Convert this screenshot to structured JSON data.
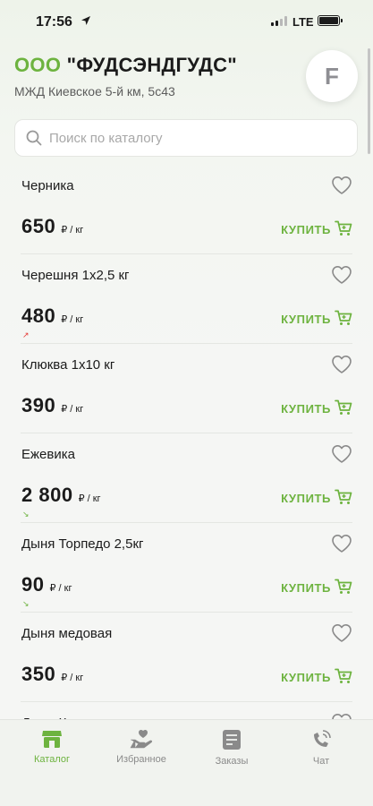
{
  "status_bar": {
    "time": "17:56",
    "network": "LTE"
  },
  "header": {
    "company_prefix": "ООО",
    "company_name": "\"ФУДСЭНДГУДС\"",
    "address": "МЖД Киевское 5-й км, 5с43",
    "avatar_letter": "F"
  },
  "search": {
    "placeholder": "Поиск по каталогу",
    "value": ""
  },
  "colors": {
    "accent": "#6db33f",
    "trend_up": "#e53935"
  },
  "products": [
    {
      "name": "Черника",
      "price": "650",
      "unit": "₽ / кг",
      "buy_label": "КУПИТЬ",
      "trend": ""
    },
    {
      "name": "Черешня 1х2,5 кг",
      "price": "480",
      "unit": "₽ / кг",
      "buy_label": "КУПИТЬ",
      "trend": "up"
    },
    {
      "name": "Клюква 1х10 кг",
      "price": "390",
      "unit": "₽ / кг",
      "buy_label": "КУПИТЬ",
      "trend": ""
    },
    {
      "name": "Ежевика",
      "price": "2 800",
      "unit": "₽ / кг",
      "buy_label": "КУПИТЬ",
      "trend": "down"
    },
    {
      "name": "Дыня Торпедо 2,5кг",
      "price": "90",
      "unit": "₽ / кг",
      "buy_label": "КУПИТЬ",
      "trend": "down"
    },
    {
      "name": "Дыня медовая",
      "price": "350",
      "unit": "₽ / кг",
      "buy_label": "КУПИТЬ",
      "trend": ""
    },
    {
      "name": "Дыня Канталупе",
      "price": "",
      "unit": "",
      "buy_label": "",
      "trend": ""
    }
  ],
  "tabbar": {
    "catalog": "Каталог",
    "favorites": "Избранное",
    "orders": "Заказы",
    "chat": "Чат",
    "active": "catalog"
  }
}
